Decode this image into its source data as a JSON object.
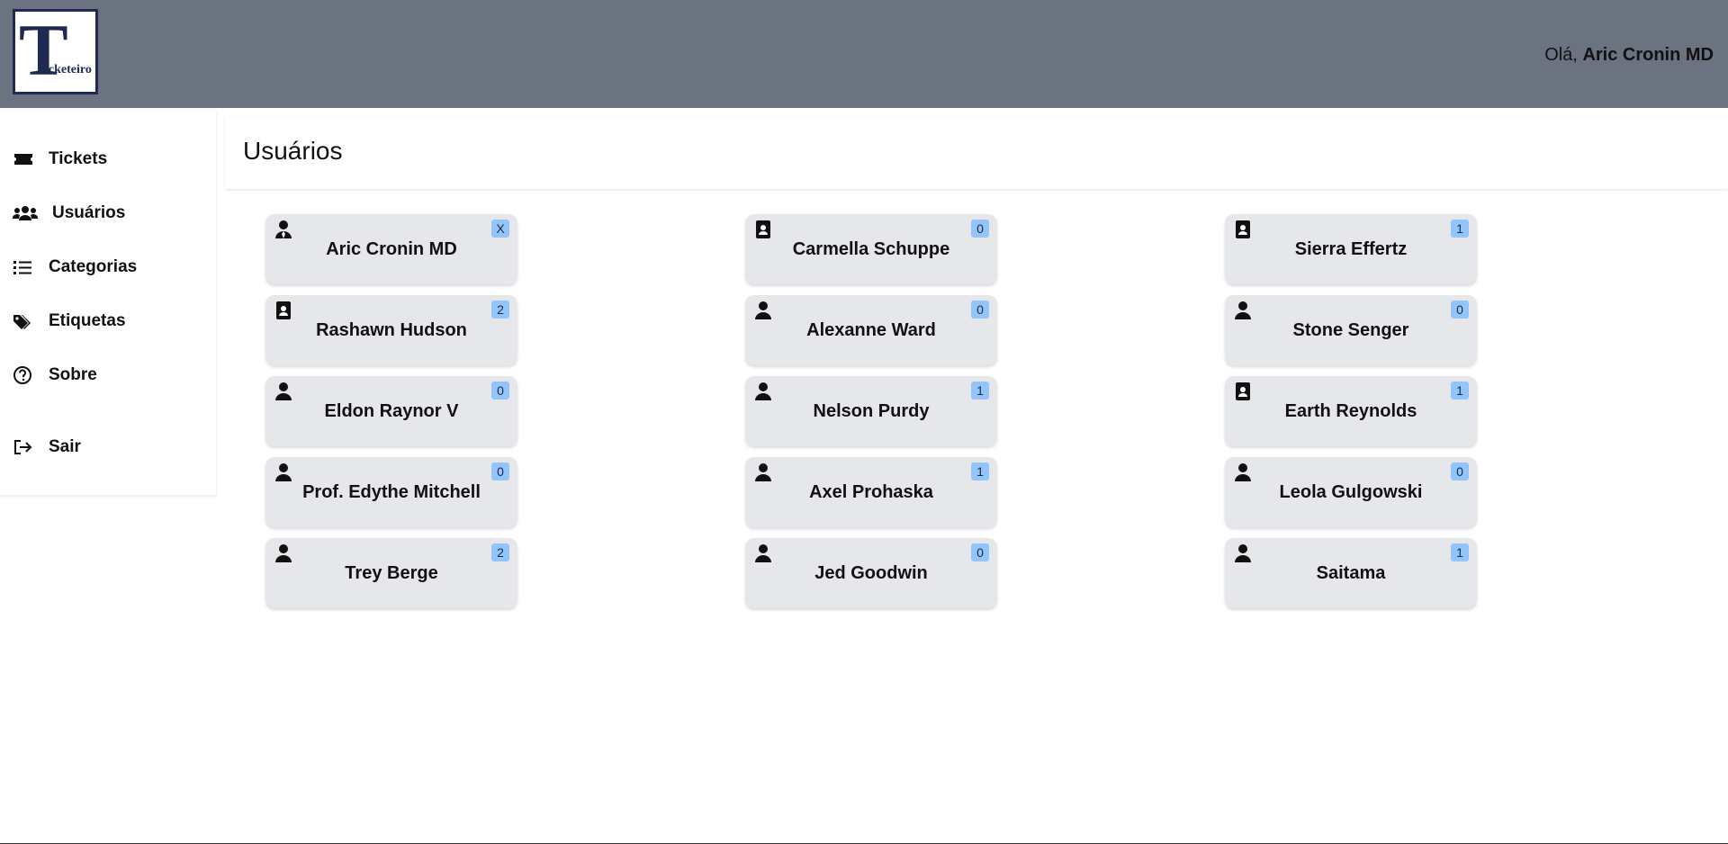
{
  "header": {
    "logo_big": "T",
    "logo_rest": "icketeiro",
    "greeting_prefix": "Olá,",
    "greeting_user": "Aric Cronin MD",
    "background": "#6b7280",
    "logo_color": "#1f2a52"
  },
  "sidebar": {
    "items": [
      {
        "label": "Tickets",
        "icon": "ticket-icon"
      },
      {
        "label": "Usuários",
        "icon": "users-icon"
      },
      {
        "label": "Categorias",
        "icon": "list-icon"
      },
      {
        "label": "Etiquetas",
        "icon": "tags-icon"
      },
      {
        "label": "Sobre",
        "icon": "question-circle-icon"
      },
      {
        "label": "Sair",
        "icon": "sign-out-icon"
      }
    ]
  },
  "page": {
    "title": "Usuários"
  },
  "users": [
    {
      "name": "Aric Cronin MD",
      "badge": "X",
      "role_icon": "user-tie-icon"
    },
    {
      "name": "Carmella Schuppe",
      "badge": "0",
      "role_icon": "id-badge-icon"
    },
    {
      "name": "Sierra Effertz",
      "badge": "1",
      "role_icon": "id-badge-icon"
    },
    {
      "name": "Rashawn Hudson",
      "badge": "2",
      "role_icon": "id-badge-icon"
    },
    {
      "name": "Alexanne Ward",
      "badge": "0",
      "role_icon": "user-icon"
    },
    {
      "name": "Stone Senger",
      "badge": "0",
      "role_icon": "user-icon"
    },
    {
      "name": "Eldon Raynor V",
      "badge": "0",
      "role_icon": "user-icon"
    },
    {
      "name": "Nelson Purdy",
      "badge": "1",
      "role_icon": "user-icon"
    },
    {
      "name": "Earth Reynolds",
      "badge": "1",
      "role_icon": "id-badge-icon"
    },
    {
      "name": "Prof. Edythe Mitchell",
      "badge": "0",
      "role_icon": "user-icon"
    },
    {
      "name": "Axel Prohaska",
      "badge": "1",
      "role_icon": "user-icon"
    },
    {
      "name": "Leola Gulgowski",
      "badge": "0",
      "role_icon": "user-icon"
    },
    {
      "name": "Trey Berge",
      "badge": "2",
      "role_icon": "user-icon"
    },
    {
      "name": "Jed Goodwin",
      "badge": "0",
      "role_icon": "user-icon"
    },
    {
      "name": "Saitama",
      "badge": "1",
      "role_icon": "user-icon"
    }
  ],
  "colors": {
    "card_bg": "#e5e7eb",
    "badge_bg": "#93c5fd"
  }
}
